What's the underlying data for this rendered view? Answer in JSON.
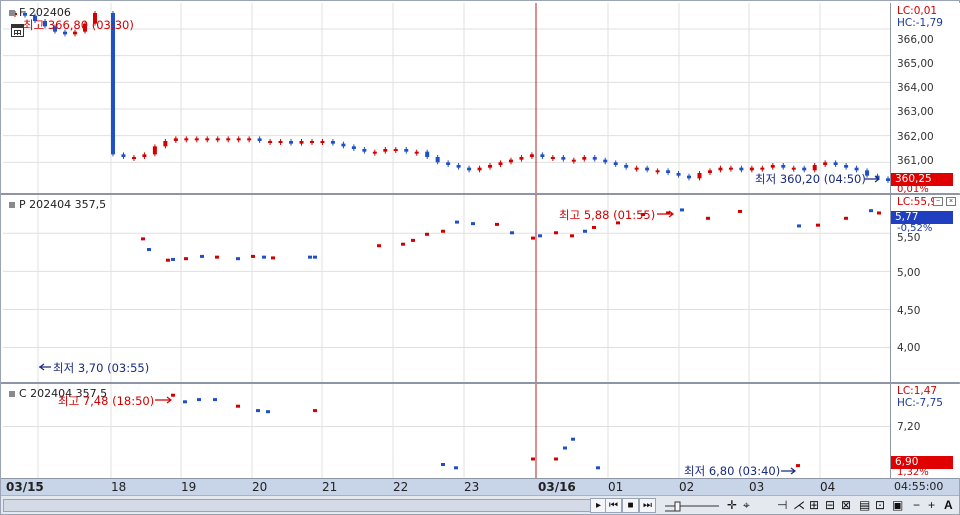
{
  "panes": [
    {
      "title": "F 202406",
      "lc": "LC:0,01",
      "hc": "HC:-1,79",
      "ticks": [
        "366,00",
        "365,00",
        "364,00",
        "363,00",
        "362,00",
        "361,00"
      ],
      "current_box": "360,25",
      "current_pct": "0,01%",
      "high_note": "최고 366,80 (03:30)",
      "low_note": "최저 360,20 (04:50)",
      "tick_values": [
        366,
        365,
        364,
        363,
        362,
        361
      ]
    },
    {
      "title": "P 202404 357,5",
      "lc": "LC:55,95",
      "hc": "HC:-1,87",
      "ticks": [
        "5,50",
        "5,00",
        "4,50",
        "4,00"
      ],
      "current_box": "5,77",
      "current_pct": "-0,52%",
      "high_note": "최고 5,88 (01:55)",
      "low_note": "최저 3,70 (03:55)"
    },
    {
      "title": "C 202404 357,5",
      "lc": "LC:1,47",
      "hc": "HC:-7,75",
      "ticks": [
        "7,20"
      ],
      "current_box": "6,90",
      "current_pct": "1,32%",
      "high_note": "최고 7,48 (18:50)",
      "low_note": "최저 6,80 (03:40)"
    }
  ],
  "x_axis": {
    "labels": [
      {
        "text": "03/15",
        "bold": true
      },
      {
        "text": "18",
        "bold": false
      },
      {
        "text": "19",
        "bold": false
      },
      {
        "text": "20",
        "bold": false
      },
      {
        "text": "21",
        "bold": false
      },
      {
        "text": "22",
        "bold": false
      },
      {
        "text": "23",
        "bold": false
      },
      {
        "text": "03/16",
        "bold": true
      },
      {
        "text": "01",
        "bold": false
      },
      {
        "text": "02",
        "bold": false
      },
      {
        "text": "03",
        "bold": false
      },
      {
        "text": "04",
        "bold": false
      }
    ],
    "time": "04:55:00"
  },
  "toolbar": {
    "minus": "−",
    "plus": "+",
    "auto": "A"
  },
  "colors": {
    "up": "#d40000",
    "down": "#1f50c8",
    "vline": "#b02020",
    "grid": "#e0e0e0"
  },
  "chart_data": [
    {
      "type": "candlestick",
      "series": [
        {
          "name": "F 202406",
          "close_path": [
            366.6,
            366.5,
            366.3,
            366.1,
            365.9,
            365.8,
            365.9,
            366.2,
            366.6,
            361.3,
            361.2,
            361.2,
            361.3,
            361.6,
            361.8,
            361.9,
            361.9,
            361.9,
            361.9,
            361.9,
            361.9,
            361.9,
            361.9,
            361.8,
            361.8,
            361.8,
            361.7,
            361.8,
            361.8,
            361.8,
            361.7,
            361.6,
            361.5,
            361.4,
            361.4,
            361.5,
            361.5,
            361.4,
            361.4,
            361.2,
            361.0,
            360.9,
            360.8,
            360.7,
            360.8,
            360.9,
            361.0,
            361.1,
            361.2,
            361.3,
            361.2,
            361.2,
            361.1,
            361.1,
            361.2,
            361.1,
            361.0,
            360.9,
            360.8,
            360.8,
            360.7,
            360.7,
            360.6,
            360.5,
            360.4,
            360.6,
            360.7,
            360.8,
            360.8,
            360.7,
            360.8,
            360.8,
            360.9,
            360.8,
            360.8,
            360.7,
            360.9,
            361.0,
            360.9,
            360.8,
            360.7,
            360.5,
            360.4,
            360.3
          ]
        }
      ],
      "ylim": [
        360.0,
        366.6
      ]
    },
    {
      "type": "scatter",
      "series": [
        {
          "name": "P 202404 357,5"
        }
      ],
      "ylim": [
        3.6,
        5.95
      ]
    },
    {
      "type": "scatter",
      "series": [
        {
          "name": "C 202404 357,5"
        }
      ],
      "ylim": [
        6.75,
        7.55
      ]
    }
  ]
}
